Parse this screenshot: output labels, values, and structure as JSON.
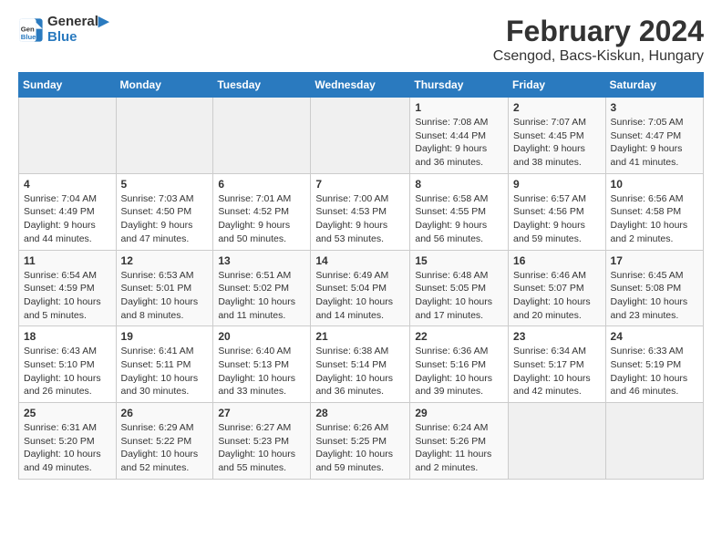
{
  "header": {
    "logo_line1": "General",
    "logo_line2": "Blue",
    "title": "February 2024",
    "subtitle": "Csengod, Bacs-Kiskun, Hungary"
  },
  "calendar": {
    "days_of_week": [
      "Sunday",
      "Monday",
      "Tuesday",
      "Wednesday",
      "Thursday",
      "Friday",
      "Saturday"
    ],
    "weeks": [
      [
        {
          "day": "",
          "info": ""
        },
        {
          "day": "",
          "info": ""
        },
        {
          "day": "",
          "info": ""
        },
        {
          "day": "",
          "info": ""
        },
        {
          "day": "1",
          "info": "Sunrise: 7:08 AM\nSunset: 4:44 PM\nDaylight: 9 hours\nand 36 minutes."
        },
        {
          "day": "2",
          "info": "Sunrise: 7:07 AM\nSunset: 4:45 PM\nDaylight: 9 hours\nand 38 minutes."
        },
        {
          "day": "3",
          "info": "Sunrise: 7:05 AM\nSunset: 4:47 PM\nDaylight: 9 hours\nand 41 minutes."
        }
      ],
      [
        {
          "day": "4",
          "info": "Sunrise: 7:04 AM\nSunset: 4:49 PM\nDaylight: 9 hours\nand 44 minutes."
        },
        {
          "day": "5",
          "info": "Sunrise: 7:03 AM\nSunset: 4:50 PM\nDaylight: 9 hours\nand 47 minutes."
        },
        {
          "day": "6",
          "info": "Sunrise: 7:01 AM\nSunset: 4:52 PM\nDaylight: 9 hours\nand 50 minutes."
        },
        {
          "day": "7",
          "info": "Sunrise: 7:00 AM\nSunset: 4:53 PM\nDaylight: 9 hours\nand 53 minutes."
        },
        {
          "day": "8",
          "info": "Sunrise: 6:58 AM\nSunset: 4:55 PM\nDaylight: 9 hours\nand 56 minutes."
        },
        {
          "day": "9",
          "info": "Sunrise: 6:57 AM\nSunset: 4:56 PM\nDaylight: 9 hours\nand 59 minutes."
        },
        {
          "day": "10",
          "info": "Sunrise: 6:56 AM\nSunset: 4:58 PM\nDaylight: 10 hours\nand 2 minutes."
        }
      ],
      [
        {
          "day": "11",
          "info": "Sunrise: 6:54 AM\nSunset: 4:59 PM\nDaylight: 10 hours\nand 5 minutes."
        },
        {
          "day": "12",
          "info": "Sunrise: 6:53 AM\nSunset: 5:01 PM\nDaylight: 10 hours\nand 8 minutes."
        },
        {
          "day": "13",
          "info": "Sunrise: 6:51 AM\nSunset: 5:02 PM\nDaylight: 10 hours\nand 11 minutes."
        },
        {
          "day": "14",
          "info": "Sunrise: 6:49 AM\nSunset: 5:04 PM\nDaylight: 10 hours\nand 14 minutes."
        },
        {
          "day": "15",
          "info": "Sunrise: 6:48 AM\nSunset: 5:05 PM\nDaylight: 10 hours\nand 17 minutes."
        },
        {
          "day": "16",
          "info": "Sunrise: 6:46 AM\nSunset: 5:07 PM\nDaylight: 10 hours\nand 20 minutes."
        },
        {
          "day": "17",
          "info": "Sunrise: 6:45 AM\nSunset: 5:08 PM\nDaylight: 10 hours\nand 23 minutes."
        }
      ],
      [
        {
          "day": "18",
          "info": "Sunrise: 6:43 AM\nSunset: 5:10 PM\nDaylight: 10 hours\nand 26 minutes."
        },
        {
          "day": "19",
          "info": "Sunrise: 6:41 AM\nSunset: 5:11 PM\nDaylight: 10 hours\nand 30 minutes."
        },
        {
          "day": "20",
          "info": "Sunrise: 6:40 AM\nSunset: 5:13 PM\nDaylight: 10 hours\nand 33 minutes."
        },
        {
          "day": "21",
          "info": "Sunrise: 6:38 AM\nSunset: 5:14 PM\nDaylight: 10 hours\nand 36 minutes."
        },
        {
          "day": "22",
          "info": "Sunrise: 6:36 AM\nSunset: 5:16 PM\nDaylight: 10 hours\nand 39 minutes."
        },
        {
          "day": "23",
          "info": "Sunrise: 6:34 AM\nSunset: 5:17 PM\nDaylight: 10 hours\nand 42 minutes."
        },
        {
          "day": "24",
          "info": "Sunrise: 6:33 AM\nSunset: 5:19 PM\nDaylight: 10 hours\nand 46 minutes."
        }
      ],
      [
        {
          "day": "25",
          "info": "Sunrise: 6:31 AM\nSunset: 5:20 PM\nDaylight: 10 hours\nand 49 minutes."
        },
        {
          "day": "26",
          "info": "Sunrise: 6:29 AM\nSunset: 5:22 PM\nDaylight: 10 hours\nand 52 minutes."
        },
        {
          "day": "27",
          "info": "Sunrise: 6:27 AM\nSunset: 5:23 PM\nDaylight: 10 hours\nand 55 minutes."
        },
        {
          "day": "28",
          "info": "Sunrise: 6:26 AM\nSunset: 5:25 PM\nDaylight: 10 hours\nand 59 minutes."
        },
        {
          "day": "29",
          "info": "Sunrise: 6:24 AM\nSunset: 5:26 PM\nDaylight: 11 hours\nand 2 minutes."
        },
        {
          "day": "",
          "info": ""
        },
        {
          "day": "",
          "info": ""
        }
      ]
    ]
  }
}
